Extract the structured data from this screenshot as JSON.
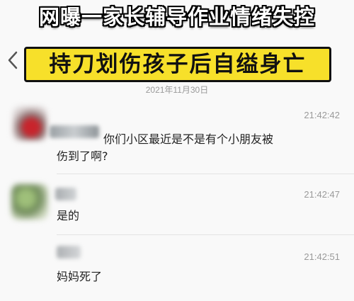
{
  "caption": {
    "title": "网曝一家长辅导作业情绪失控",
    "subtitle": "持刀划伤孩子后自缢身亡"
  },
  "chat": {
    "date": "2021年11月30日",
    "messages": [
      {
        "time": "21:42:42",
        "text_line1": "你们小区最近是不是有个小朋友被",
        "text_line2": "伤到了啊?"
      },
      {
        "time": "21:42:47",
        "text_line1": "是的"
      },
      {
        "time": "21:42:51",
        "text_line1": "妈妈死了"
      }
    ]
  },
  "icons": {
    "back": "chevron-left-icon"
  },
  "colors": {
    "subtitle_background": "#f7e02a",
    "caption_outline": "#000000",
    "timestamp": "#9a9a9a",
    "message_text": "#222222"
  }
}
